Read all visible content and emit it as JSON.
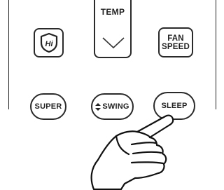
{
  "remote": {
    "temp_button": {
      "label": "TEMP",
      "icon": "chevron-down-icon"
    },
    "hi_button": {
      "icon_text": "Hi",
      "icon": "shield-icon"
    },
    "fan_speed_button": {
      "line1": "FAN",
      "line2": "SPEED"
    },
    "super_button": {
      "label": "SUPER"
    },
    "swing_button": {
      "label": "SWING",
      "icon": "up-down-arrow-icon"
    },
    "sleep_button": {
      "label": "SLEEP"
    },
    "pointer": {
      "icon": "pointing-hand-icon"
    }
  },
  "colors": {
    "outline": "#2a2a2a",
    "background": "#ffffff"
  }
}
